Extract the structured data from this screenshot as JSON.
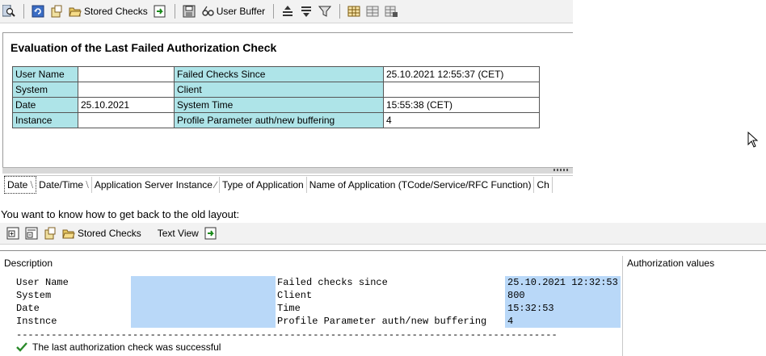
{
  "top": {
    "toolbar": {
      "stored_checks": "Stored Checks",
      "user_buffer": "User Buffer"
    },
    "title": "Evaluation of the Last Failed Authorization Check",
    "rows": [
      {
        "l1": "User Name",
        "v1": "",
        "l2": "Failed Checks Since",
        "v2": "25.10.2021 12:55:37 (CET)"
      },
      {
        "l1": "System",
        "v1": "",
        "l2": "Client",
        "v2": ""
      },
      {
        "l1": "Date",
        "v1": "25.10.2021",
        "l2": "System Time",
        "v2": "15:55:38 (CET)"
      },
      {
        "l1": "Instance",
        "v1": "",
        "l2": "Profile Parameter auth/new buffering",
        "v2": "4"
      }
    ],
    "columns": [
      "Date",
      "Date/Time",
      "Application Server Instance",
      "Type of Application",
      "Name of Application (TCode/Service/RFC Function)",
      "Ch"
    ]
  },
  "question": "You want to know how to get back to the old layout:",
  "bottom": {
    "toolbar": {
      "stored_checks": "Stored Checks",
      "text_view": "Text View"
    },
    "description_header": "Description",
    "auth_values_header": "Authorization values",
    "rows": [
      {
        "l1": "User Name",
        "l2": "Failed checks since",
        "v2": "25.10.2021 12:32:53"
      },
      {
        "l1": "System",
        "l2": "Client",
        "v2": "800"
      },
      {
        "l1": "Date",
        "l2": "Time",
        "v2": "15:32:53"
      },
      {
        "l1": "Instnce",
        "l2": "Profile Parameter auth/new buffering",
        "v2": "4"
      }
    ],
    "dashes": "--------------------------------------------------------------------------------------------------------------",
    "success": "The last authorization check was successful"
  }
}
